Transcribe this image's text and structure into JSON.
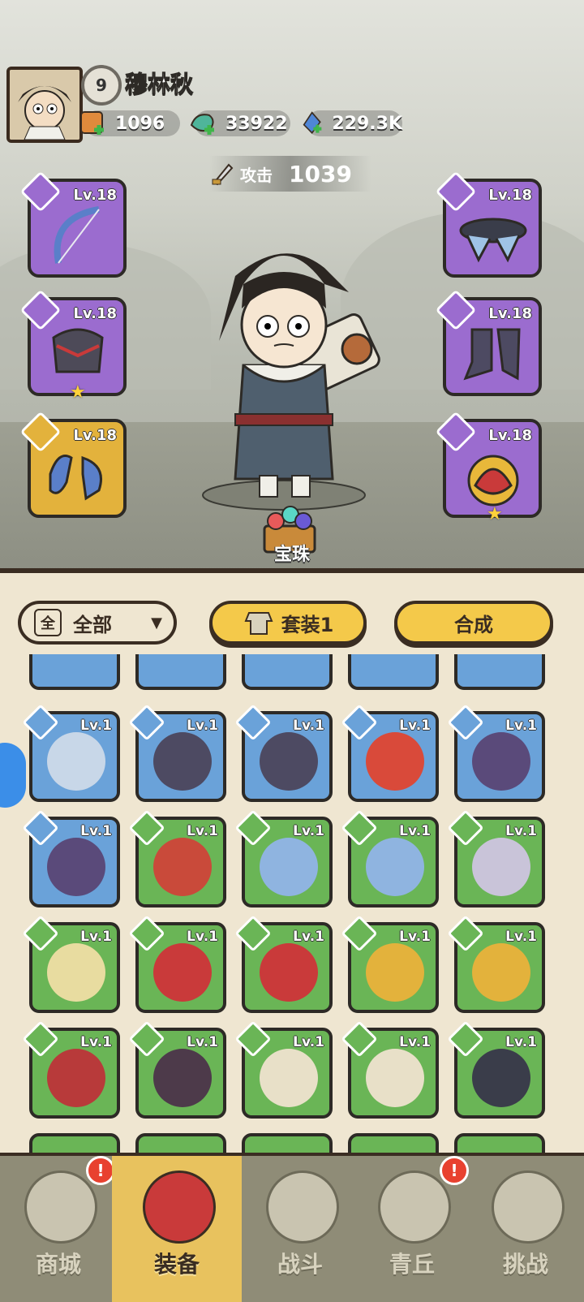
{
  "player": {
    "level": "9",
    "name": "穆林秋",
    "resources": [
      {
        "icon": "scroll-icon",
        "value": "1096"
      },
      {
        "icon": "jade-icon",
        "value": "33922"
      },
      {
        "icon": "crystal-icon",
        "value": "229.3K"
      }
    ],
    "attack_label": "攻击",
    "attack_value": "1039"
  },
  "equipped": {
    "weapon": {
      "level": "Lv.18",
      "icon": "bow-icon",
      "rarity": "purple"
    },
    "armor": {
      "level": "Lv.18",
      "icon": "helmet-icon",
      "rarity": "purple",
      "stars": 1
    },
    "ring": {
      "level": "Lv.18",
      "icon": "bracer-icon",
      "rarity": "gold"
    },
    "belt": {
      "level": "Lv.18",
      "icon": "belt-icon",
      "rarity": "purple"
    },
    "boots": {
      "level": "Lv.18",
      "icon": "boots-icon",
      "rarity": "purple"
    },
    "amulet": {
      "level": "Lv.18",
      "icon": "amulet-icon",
      "rarity": "purple",
      "stars": 1
    }
  },
  "gem_label": "宝珠",
  "toolbar": {
    "filter_icon_label": "全",
    "filter_label": "全部",
    "set_label": "套装1",
    "merge_label": "合成"
  },
  "inventory": [
    [
      {
        "level": "Lv.1",
        "rarity": "blue"
      },
      {
        "level": "Lv.1",
        "rarity": "blue"
      },
      {
        "level": "Lv.1",
        "rarity": "blue"
      },
      {
        "level": "Lv.1",
        "rarity": "blue"
      },
      {
        "level": "Lv.1",
        "rarity": "blue"
      }
    ],
    [
      {
        "level": "Lv.1",
        "rarity": "blue"
      },
      {
        "level": "Lv.1",
        "rarity": "blue"
      },
      {
        "level": "Lv.1",
        "rarity": "green"
      },
      {
        "level": "Lv.1",
        "rarity": "green"
      },
      {
        "level": "Lv.1",
        "rarity": "green"
      }
    ],
    [
      {
        "level": "Lv.1",
        "rarity": "green"
      },
      {
        "level": "Lv.1",
        "rarity": "green"
      },
      {
        "level": "Lv.1",
        "rarity": "green"
      },
      {
        "level": "Lv.1",
        "rarity": "green"
      },
      {
        "level": "Lv.1",
        "rarity": "green"
      }
    ],
    [
      {
        "level": "Lv.1",
        "rarity": "green"
      },
      {
        "level": "Lv.1",
        "rarity": "green"
      },
      {
        "level": "Lv.1",
        "rarity": "green"
      },
      {
        "level": "Lv.1",
        "rarity": "green"
      },
      {
        "level": "Lv.1",
        "rarity": "green"
      }
    ]
  ],
  "nav": [
    {
      "label": "商城",
      "icon": "shop-icon",
      "badge": "!"
    },
    {
      "label": "装备",
      "icon": "equipment-icon",
      "active": true
    },
    {
      "label": "战斗",
      "icon": "battle-icon"
    },
    {
      "label": "青丘",
      "icon": "mountain-icon",
      "badge": "!"
    },
    {
      "label": "挑战",
      "icon": "challenge-icon"
    }
  ],
  "colors": {
    "purple": "#9b6ccf",
    "gold": "#e3b23c",
    "blue": "#6aa2d9",
    "green": "#6ab556",
    "accent_yellow": "#f4c94a",
    "badge_red": "#e8412f"
  }
}
